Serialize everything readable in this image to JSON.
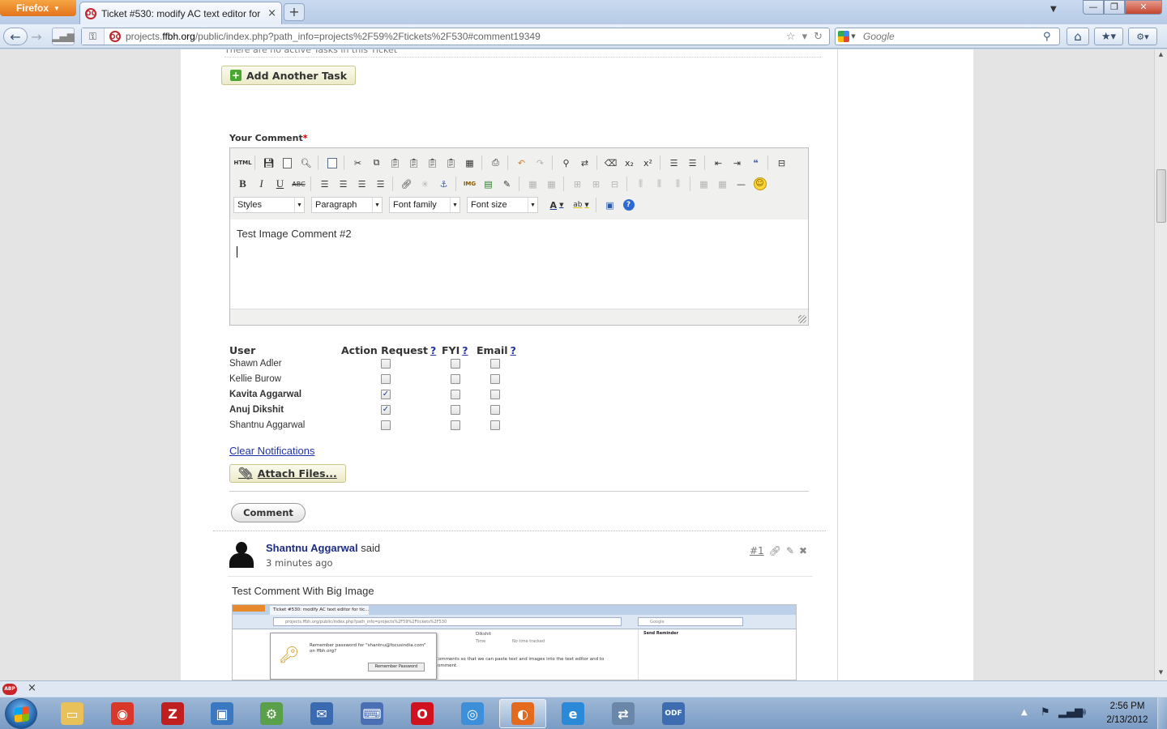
{
  "browser": {
    "app_button": "Firefox",
    "tab_title": "Ticket #530: modify AC text editor for tic...",
    "tab_favicon": "OC",
    "url_plain": "projects.",
    "url_domain": "ffbh.org",
    "url_rest": "/public/index.php?path_info=projects%2F59%2Ftickets%2F530#comment19349",
    "search_placeholder": "Google"
  },
  "page": {
    "tasks_note": "There are no active Tasks in this Ticket",
    "add_task_label": "Add Another Task",
    "comment_label": "Your Comment",
    "required_mark": "*"
  },
  "editor": {
    "html_button": "HTML",
    "selects": {
      "styles": "Styles",
      "format": "Paragraph",
      "font_family": "Font family",
      "font_size": "Font size"
    },
    "toolbar_labels": {
      "bold": "B",
      "italic": "I",
      "underline": "U",
      "strike": "ABC",
      "subscript": "x₂",
      "superscript": "x²",
      "image": "IMG",
      "font_color": "A",
      "highlight": "ab",
      "help": "?"
    },
    "content_line1": "Test Image Comment #2"
  },
  "notifications": {
    "headers": {
      "user": "User",
      "action": "Action Request",
      "fyi": "FYI",
      "email": "Email",
      "help": "?"
    },
    "users": [
      {
        "name": "Shawn Adler",
        "bold": false,
        "action": false,
        "fyi": false,
        "email": false
      },
      {
        "name": "Kellie Burow",
        "bold": false,
        "action": false,
        "fyi": false,
        "email": false
      },
      {
        "name": "Kavita Aggarwal",
        "bold": true,
        "action": true,
        "fyi": false,
        "email": false
      },
      {
        "name": "Anuj Dikshit",
        "bold": true,
        "action": true,
        "fyi": false,
        "email": false
      },
      {
        "name": "Shantnu Aggarwal",
        "bold": false,
        "action": false,
        "fyi": false,
        "email": false
      }
    ],
    "clear_label": "Clear Notifications",
    "attach_label": "Attach Files...",
    "submit_label": "Comment"
  },
  "comment": {
    "author": "Shantnu Aggarwal",
    "said": "said",
    "time": "3 minutes ago",
    "number": "#1",
    "text": "Test Comment With Big Image",
    "embedded": {
      "tab": "Ticket #530: modify AC text editor for tic...",
      "url": "projects.ffbh.org/public/index.php?path_info=projects%2F59%2Ftickets%2F530",
      "search": "Google",
      "side_heading": "Send Reminder",
      "top_name": "Dikshit",
      "time_label": "Time",
      "time_value": "No time tracked",
      "popup_text": "Remember password for \"shantnu@focusindia.com\" on ffbh.org?",
      "popup_button": "Remember Password",
      "body_line1": "Comments so that we can paste text and images into the text editor and to",
      "body_line2": "comment."
    }
  },
  "addon_bar": {
    "abp_label": "ABP",
    "close": "×"
  },
  "taskbar": {
    "apps": [
      {
        "name": "explorer",
        "glyph": "▭",
        "color": "#e8c15a"
      },
      {
        "name": "chrome",
        "glyph": "◉",
        "color": "#d9372a"
      },
      {
        "name": "filezilla",
        "glyph": "Z",
        "color": "#bf1f1f"
      },
      {
        "name": "virtualbox",
        "glyph": "▣",
        "color": "#3b78c2"
      },
      {
        "name": "network-app",
        "glyph": "⚙",
        "color": "#5aa04a"
      },
      {
        "name": "thunderbird",
        "glyph": "✉",
        "color": "#3a6ab0"
      },
      {
        "name": "putty",
        "glyph": "⌨",
        "color": "#4a6fb5"
      },
      {
        "name": "opera",
        "glyph": "O",
        "color": "#d0121e"
      },
      {
        "name": "safari",
        "glyph": "◎",
        "color": "#3c8fd8"
      },
      {
        "name": "firefox",
        "glyph": "◐",
        "color": "#e46a1d"
      },
      {
        "name": "internet-explorer",
        "glyph": "e",
        "color": "#2a8ad8"
      },
      {
        "name": "network-connect",
        "glyph": "⇄",
        "color": "#6a86a8"
      },
      {
        "name": "odf-document",
        "glyph": "ODF",
        "color": "#3d6db0"
      }
    ],
    "time": "2:56 PM",
    "date": "2/13/2012"
  }
}
